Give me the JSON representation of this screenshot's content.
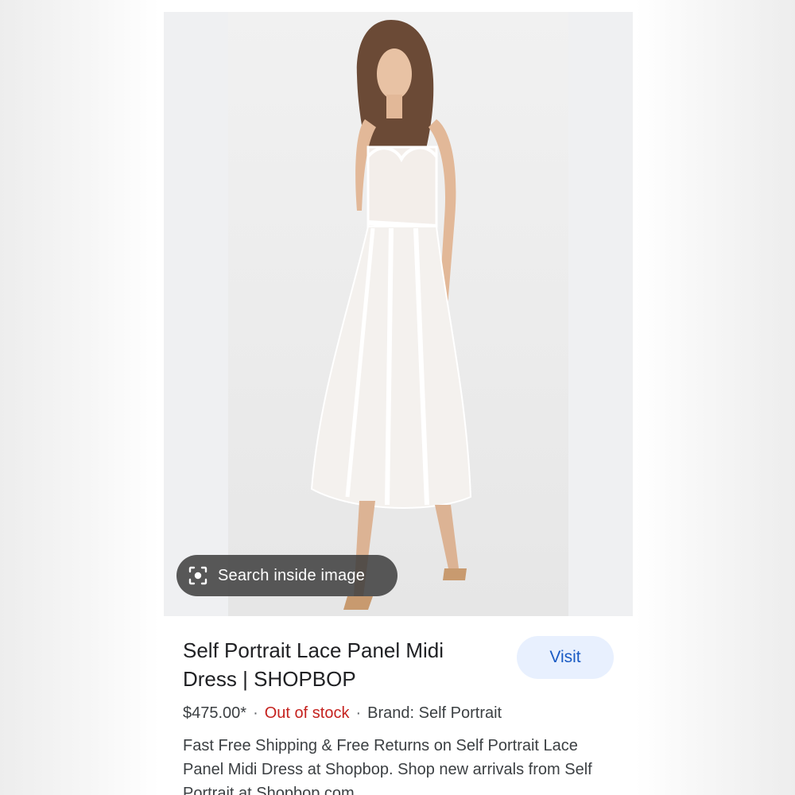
{
  "image_overlay": {
    "lens_label": "Search inside image",
    "icon": "lens-search-icon"
  },
  "product": {
    "title": "Self Portrait Lace Panel Midi Dress | SHOPBOP",
    "price": "$475.00*",
    "separator": "·",
    "stock_status": "Out of stock",
    "brand": "Brand: Self Portrait",
    "description": "Fast Free Shipping & Free Returns on Self Portrait Lace Panel Midi Dress at Shopbop. Shop new arrivals from Self Portrait at Shopbop.com"
  },
  "actions": {
    "visit_label": "Visit"
  },
  "colors": {
    "stock_red": "#c5221f",
    "visit_bg": "#e8f0fe",
    "visit_text": "#1a5bc4"
  }
}
